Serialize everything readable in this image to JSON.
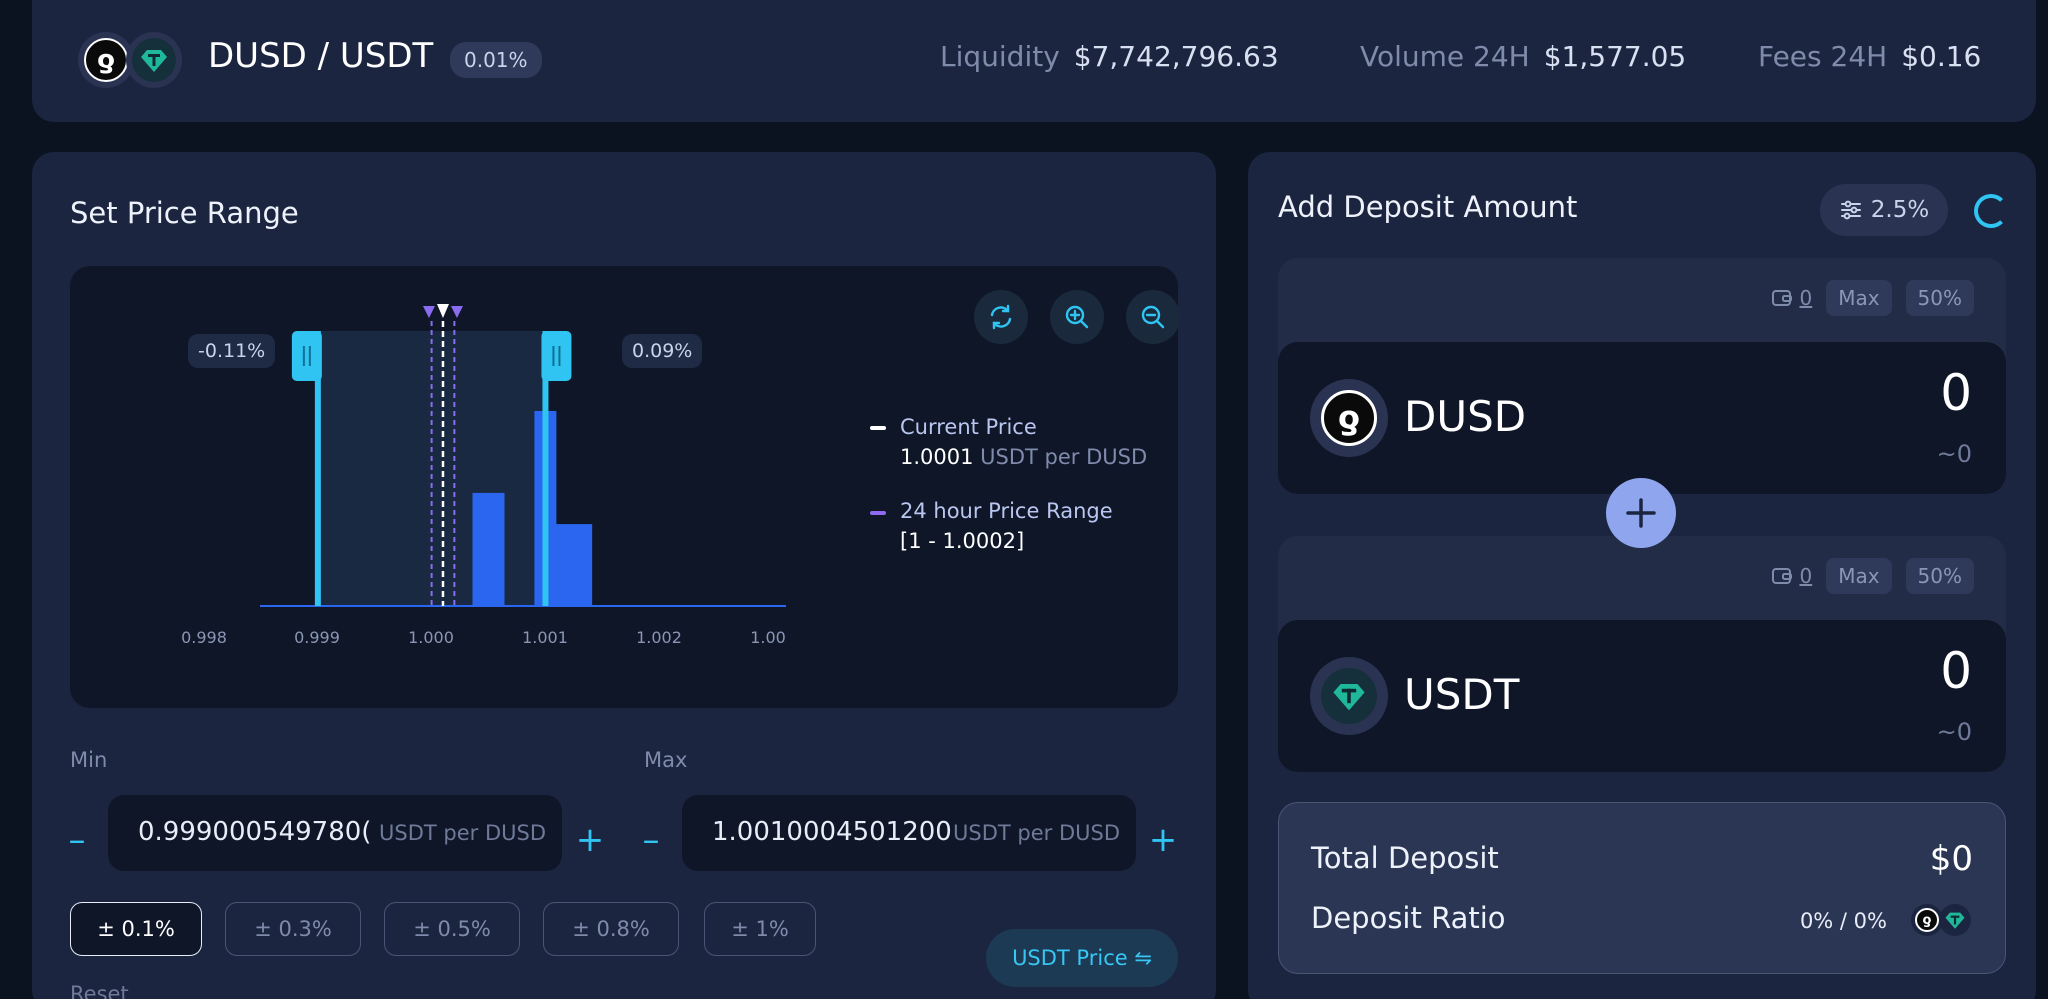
{
  "header": {
    "pair_title": "DUSD / USDT",
    "fee_tier": "0.01%",
    "liquidity_label": "Liquidity",
    "liquidity_value": "$7,742,796.63",
    "volume_label": "Volume 24H",
    "volume_value": "$1,577.05",
    "fees_label": "Fees 24H",
    "fees_value": "$0.16",
    "token_a_icon": "dusd-logo-icon",
    "token_b_icon": "usdt-logo-icon"
  },
  "price_range": {
    "title": "Set Price Range",
    "lower_pct": "-0.11%",
    "upper_pct": "0.09%",
    "ticks": [
      "0.998",
      "0.999",
      "1.000",
      "1.001",
      "1.002",
      "1.00"
    ],
    "legend": {
      "current_price_label": "Current Price",
      "current_price_value": "1.0001",
      "current_price_unit": "USDT per DUSD",
      "range_label": "24 hour Price Range",
      "range_value": "[1 - 1.0002]"
    },
    "controls": [
      "refresh-icon",
      "zoom-in-icon",
      "zoom-out-icon"
    ],
    "min_label": "Min",
    "min_value": "0.999000549780(",
    "max_label": "Max",
    "max_value": "1.0010004501200;",
    "unit": "USDT per DUSD",
    "pct_buttons": [
      "± 0.1%",
      "± 0.3%",
      "± 0.5%",
      "± 0.8%",
      "± 1%"
    ],
    "active_pct": "± 0.1%",
    "usdt_price_button": "USDT Price ⇋",
    "reset_label": "Reset",
    "colors": {
      "accent": "#2fc4f2",
      "bar": "#2a66f0",
      "range_purple": "#8b6cf0"
    }
  },
  "chart_data": {
    "type": "bar",
    "x": [
      1.0005,
      1.001,
      1.0012
    ],
    "values": [
      58,
      100,
      42
    ],
    "current_price": 1.0001,
    "range_min": 0.99900054978,
    "range_max": 1.00100045012,
    "xlim": [
      0.998,
      1.003
    ]
  },
  "deposit": {
    "title": "Add Deposit Amount",
    "slippage": "2.5%",
    "tokens": [
      {
        "name": "DUSD",
        "balance": "0",
        "amount": "0",
        "approx": "~0",
        "icon": "dusd-logo-icon"
      },
      {
        "name": "USDT",
        "balance": "0",
        "amount": "0",
        "approx": "~0",
        "icon": "usdt-logo-icon"
      }
    ],
    "max_label": "Max",
    "half_label": "50%",
    "total_label": "Total Deposit",
    "total_value": "$0",
    "ratio_label": "Deposit Ratio",
    "ratio_value": "0% / 0%"
  }
}
